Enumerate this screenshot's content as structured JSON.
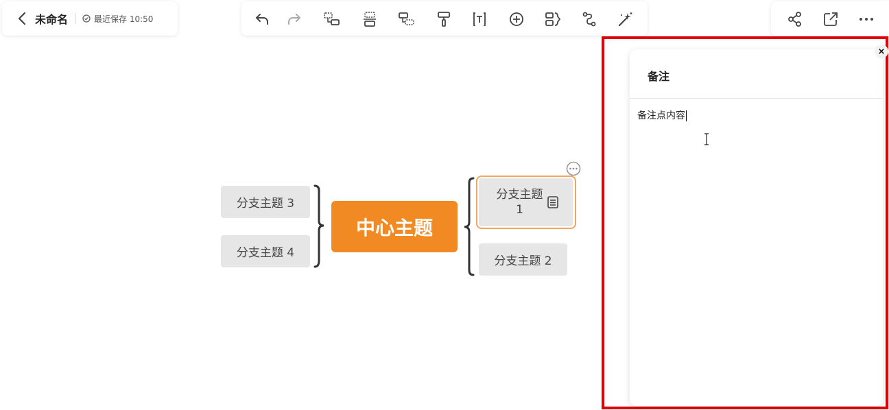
{
  "header": {
    "doc_title": "未命名",
    "save_status": "最近保存 10:50"
  },
  "toolbar": {
    "buttons": [
      "undo-icon",
      "redo-icon",
      "insert-subtopic-icon",
      "insert-sibling-icon",
      "insert-parent-icon",
      "format-painter-icon",
      "insert-text-icon",
      "insert-icon",
      "summary-icon",
      "relationship-icon",
      "magic-wand-icon"
    ]
  },
  "actions": {
    "buttons": [
      "share-icon",
      "export-icon",
      "more-icon"
    ]
  },
  "mindmap": {
    "center": "中心主题",
    "branches": {
      "b1": "分支主题 1",
      "b2": "分支主题 2",
      "b3": "分支主题 3",
      "b4": "分支主题 4"
    },
    "center_color": "#f28a24",
    "selected_border_color": "#f0a65e"
  },
  "notes_panel": {
    "title": "备注",
    "content": "备注点内容",
    "close_label": "×",
    "highlight_color": "#e30000"
  }
}
